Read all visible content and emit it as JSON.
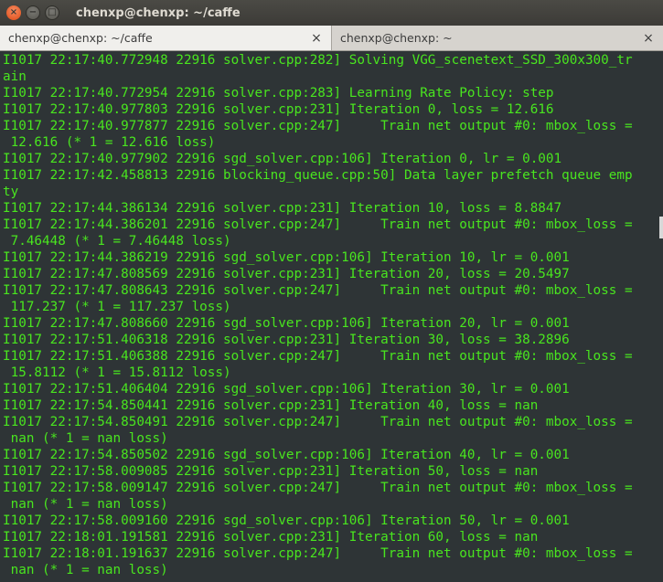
{
  "window": {
    "title": "chenxp@chenxp: ~/caffe",
    "close_glyph": "×",
    "minimize_glyph": "−",
    "maximize_glyph": "□"
  },
  "tabs": [
    {
      "label": "chenxp@chenxp: ~/caffe",
      "close_glyph": "×",
      "active": true
    },
    {
      "label": "chenxp@chenxp: ~",
      "close_glyph": "×",
      "active": false
    }
  ],
  "terminal": {
    "text_color": "#49e51f",
    "background": "#2e3436",
    "lines": [
      "I1017 22:17:40.772948 22916 solver.cpp:282] Solving VGG_scenetext_SSD_300x300_tr",
      "ain",
      "I1017 22:17:40.772954 22916 solver.cpp:283] Learning Rate Policy: step",
      "I1017 22:17:40.977803 22916 solver.cpp:231] Iteration 0, loss = 12.616",
      "I1017 22:17:40.977877 22916 solver.cpp:247]     Train net output #0: mbox_loss =",
      " 12.616 (* 1 = 12.616 loss)",
      "I1017 22:17:40.977902 22916 sgd_solver.cpp:106] Iteration 0, lr = 0.001",
      "I1017 22:17:42.458813 22916 blocking_queue.cpp:50] Data layer prefetch queue emp",
      "ty",
      "I1017 22:17:44.386134 22916 solver.cpp:231] Iteration 10, loss = 8.8847",
      "I1017 22:17:44.386201 22916 solver.cpp:247]     Train net output #0: mbox_loss =",
      " 7.46448 (* 1 = 7.46448 loss)",
      "I1017 22:17:44.386219 22916 sgd_solver.cpp:106] Iteration 10, lr = 0.001",
      "I1017 22:17:47.808569 22916 solver.cpp:231] Iteration 20, loss = 20.5497",
      "I1017 22:17:47.808643 22916 solver.cpp:247]     Train net output #0: mbox_loss =",
      " 117.237 (* 1 = 117.237 loss)",
      "I1017 22:17:47.808660 22916 sgd_solver.cpp:106] Iteration 20, lr = 0.001",
      "I1017 22:17:51.406318 22916 solver.cpp:231] Iteration 30, loss = 38.2896",
      "I1017 22:17:51.406388 22916 solver.cpp:247]     Train net output #0: mbox_loss =",
      " 15.8112 (* 1 = 15.8112 loss)",
      "I1017 22:17:51.406404 22916 sgd_solver.cpp:106] Iteration 30, lr = 0.001",
      "I1017 22:17:54.850441 22916 solver.cpp:231] Iteration 40, loss = nan",
      "I1017 22:17:54.850491 22916 solver.cpp:247]     Train net output #0: mbox_loss =",
      " nan (* 1 = nan loss)",
      "I1017 22:17:54.850502 22916 sgd_solver.cpp:106] Iteration 40, lr = 0.001",
      "I1017 22:17:58.009085 22916 solver.cpp:231] Iteration 50, loss = nan",
      "I1017 22:17:58.009147 22916 solver.cpp:247]     Train net output #0: mbox_loss =",
      " nan (* 1 = nan loss)",
      "I1017 22:17:58.009160 22916 sgd_solver.cpp:106] Iteration 50, lr = 0.001",
      "I1017 22:18:01.191581 22916 solver.cpp:231] Iteration 60, loss = nan",
      "I1017 22:18:01.191637 22916 solver.cpp:247]     Train net output #0: mbox_loss =",
      " nan (* 1 = nan loss)"
    ]
  }
}
